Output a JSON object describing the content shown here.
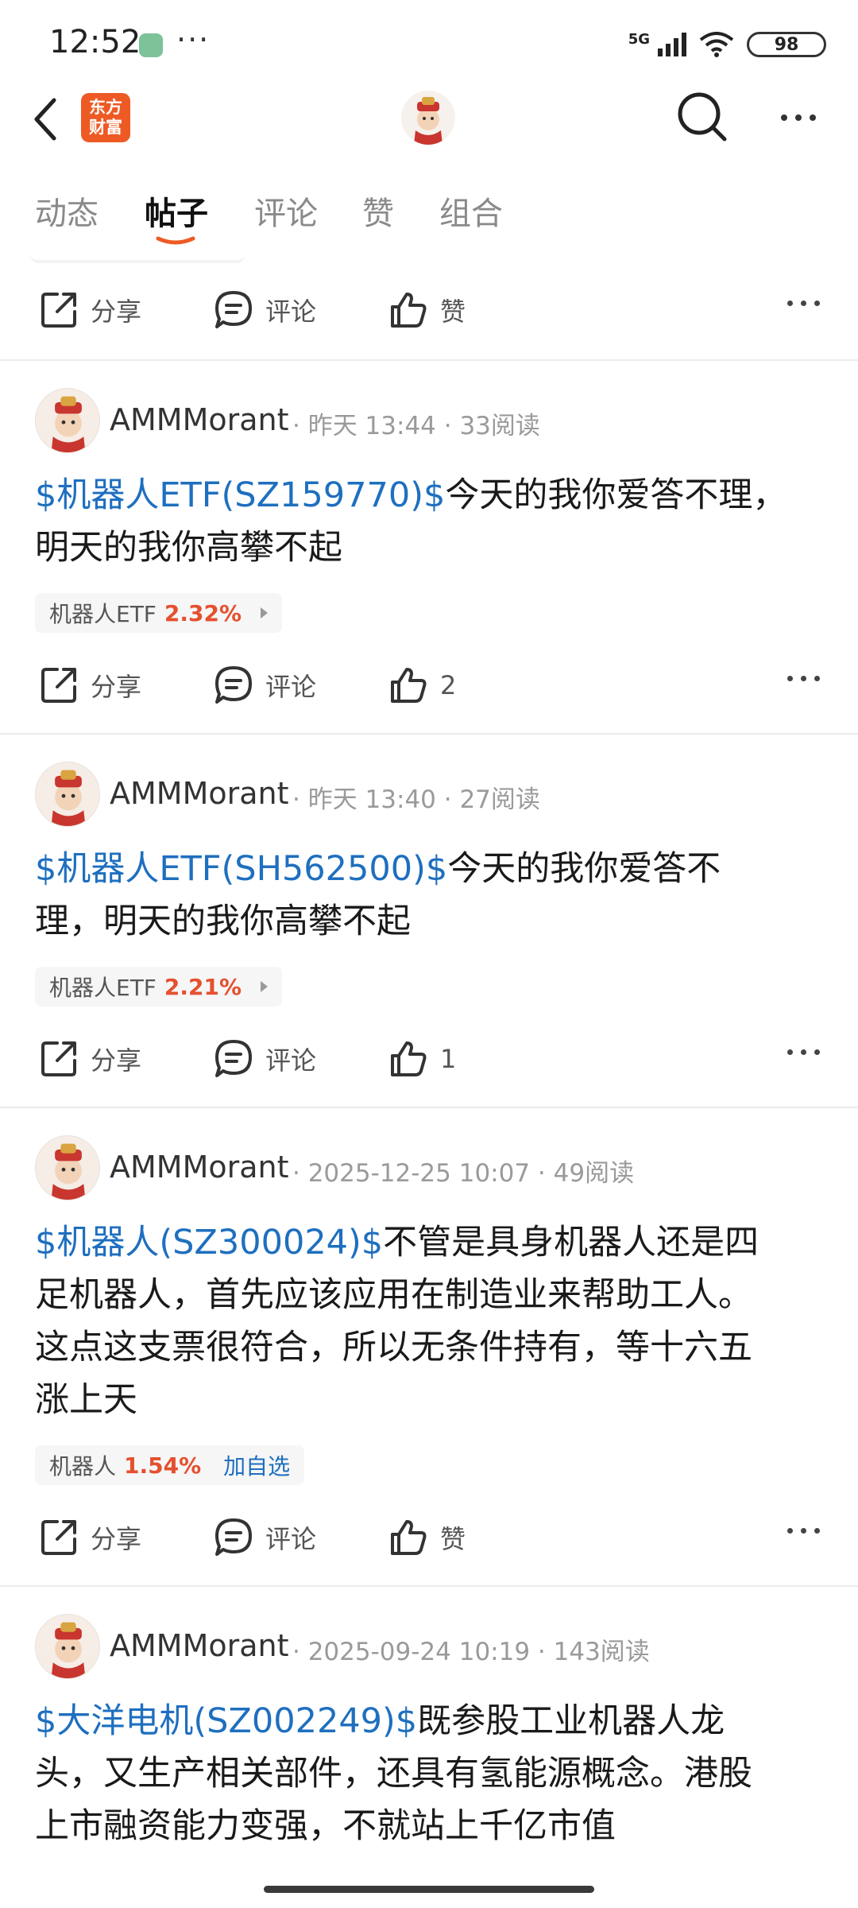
{
  "status_bar": {
    "time": "12:52",
    "more": "···",
    "network": "5G",
    "battery": "98"
  },
  "nav": {
    "brand_line1": "东方",
    "brand_line2": "财富"
  },
  "tabs": [
    "动态",
    "帖子",
    "评论",
    "赞",
    "组合"
  ],
  "active_tab": "帖子",
  "labels": {
    "share": "分享",
    "comment": "评论",
    "like": "赞",
    "add_watch": "加自选"
  },
  "top_actions": {
    "like_value": "赞"
  },
  "posts": [
    {
      "author": "AMMMorant",
      "meta": "· 昨天 13:44 · 33阅读",
      "stock_link": "$机器人ETF(SZ159770)$",
      "line1_rest": "今天的我你爱答不理，",
      "line2": "明天的我你高攀不起",
      "tag_name": "机器人ETF",
      "tag_pct": "2.32%",
      "like_value": "2"
    },
    {
      "author": "AMMMorant",
      "meta": "· 昨天 13:40 · 27阅读",
      "stock_link": "$机器人ETF(SH562500)$",
      "line1_rest": "今天的我你爱答不",
      "line2": "理，明天的我你高攀不起",
      "tag_name": "机器人ETF",
      "tag_pct": "2.21%",
      "like_value": "1"
    },
    {
      "author": "AMMMorant",
      "meta": "· 2025-12-25 10:07 · 49阅读",
      "stock_link": "$机器人(SZ300024)$",
      "line1_rest": "不管是具身机器人还是四",
      "line2": "足机器人，首先应该应用在制造业来帮助工人。",
      "line3": "这点这支票很符合，所以无条件持有，等十六五",
      "line4": "涨上天",
      "tag_name": "机器人",
      "tag_pct": "1.54%",
      "like_value": "赞"
    },
    {
      "author": "AMMMorant",
      "meta": "· 2025-09-24 10:19 · 143阅读",
      "stock_link": "$大洋电机(SZ002249)$",
      "line1_rest": "既参股工业机器人龙",
      "line2": "头，又生产相关部件，还具有氢能源概念。港股",
      "line3": "上市融资能力变强，不就站上千亿市值"
    }
  ],
  "colors": {
    "link": "#1e6fbf",
    "up": "#e5502f",
    "accent": "#ee5a24"
  }
}
